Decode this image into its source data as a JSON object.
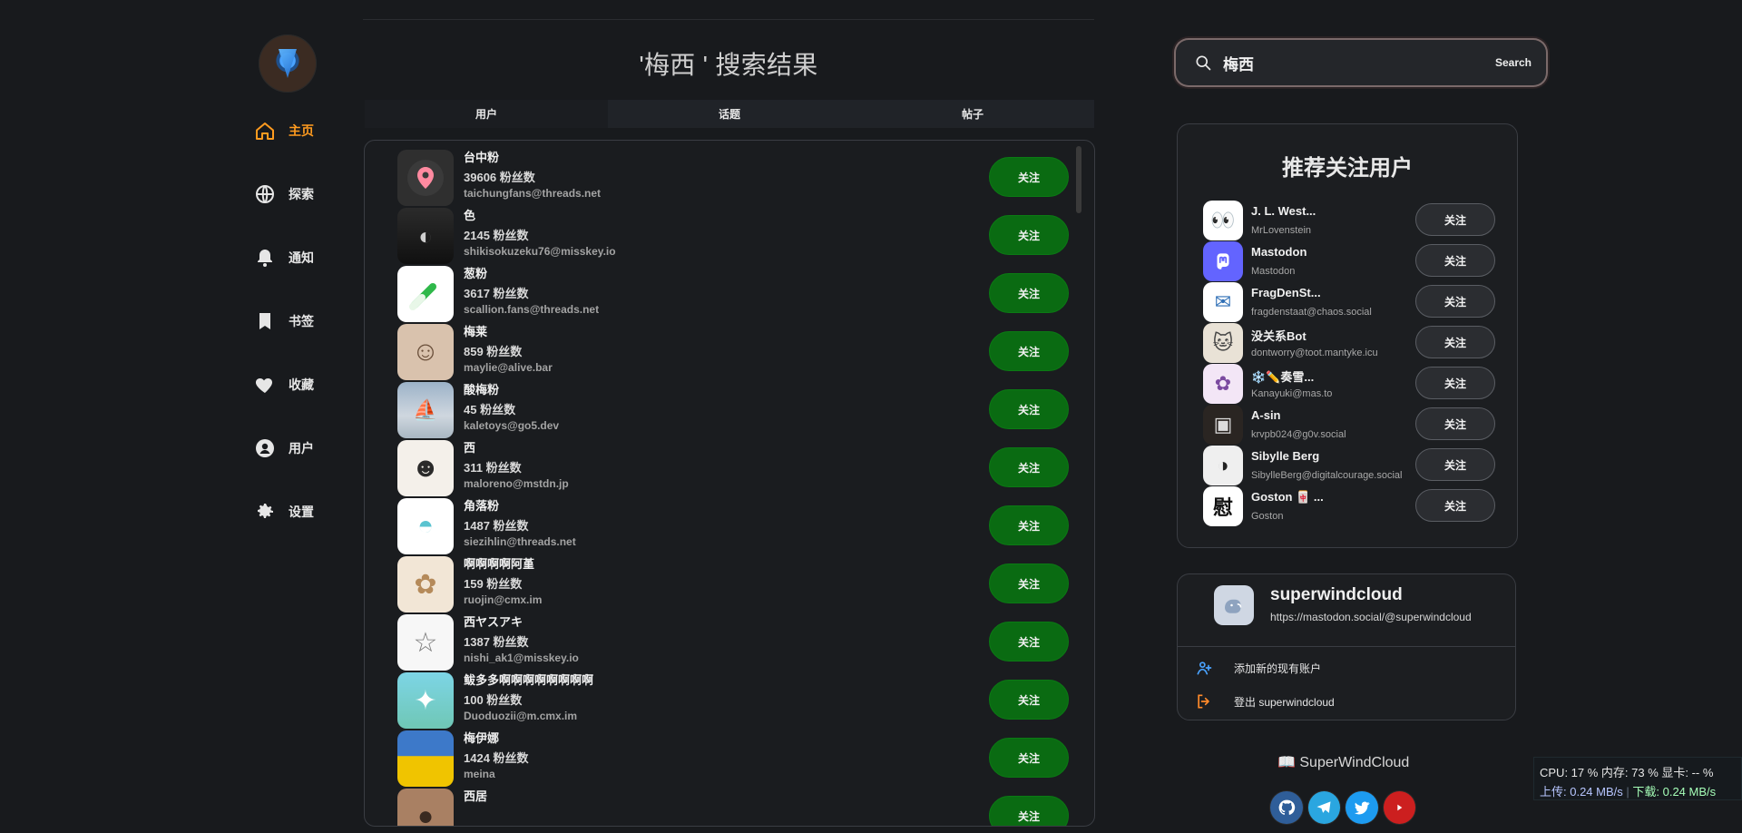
{
  "nav": {
    "items": [
      {
        "label": "主页",
        "icon": "home-icon",
        "active": true
      },
      {
        "label": "探索",
        "icon": "globe-icon",
        "active": false
      },
      {
        "label": "通知",
        "icon": "bell-icon",
        "active": false
      },
      {
        "label": "书签",
        "icon": "bookmark-icon",
        "active": false
      },
      {
        "label": "收藏",
        "icon": "heart-icon",
        "active": false
      },
      {
        "label": "用户",
        "icon": "user-icon",
        "active": false
      },
      {
        "label": "设置",
        "icon": "gear-icon",
        "active": false
      }
    ]
  },
  "main": {
    "title": "'梅西 ' 搜索结果",
    "tabs": [
      {
        "label": "用户",
        "active": true
      },
      {
        "label": "话题",
        "active": false
      },
      {
        "label": "帖子",
        "active": false
      }
    ],
    "results": [
      {
        "name": "台中粉",
        "fans": "39606 粉丝数",
        "handle": "taichungfans@threads.net",
        "icon": "map-pin-icon",
        "follow": "关注"
      },
      {
        "name": "色",
        "fans": "2145 粉丝数",
        "handle": "shikisokuzeku76@misskey.io",
        "icon": "portrait-icon",
        "follow": "关注"
      },
      {
        "name": "葱粉",
        "fans": "3617 粉丝数",
        "handle": "scallion.fans@threads.net",
        "icon": "scallion-icon",
        "follow": "关注"
      },
      {
        "name": "梅莱",
        "fans": "859 粉丝数",
        "handle": "maylie@alive.bar",
        "icon": "cartoon-person-icon",
        "follow": "关注"
      },
      {
        "name": "酸梅粉",
        "fans": "45 粉丝数",
        "handle": "kaletoys@go5.dev",
        "icon": "landscape-icon",
        "follow": "关注"
      },
      {
        "name": "西",
        "fans": "311 粉丝数",
        "handle": "maloreno@mstdn.jp",
        "icon": "anime-face-icon",
        "follow": "关注"
      },
      {
        "name": "角落粉",
        "fans": "1487 粉丝数",
        "handle": "siezihlin@threads.net",
        "icon": "dino-icon",
        "follow": "关注"
      },
      {
        "name": "啊啊啊啊阿堇",
        "fans": "159 粉丝数",
        "handle": "ruojin@cmx.im",
        "icon": "anime-girl-icon",
        "follow": "关注"
      },
      {
        "name": "西ヤスアキ",
        "fans": "1387 粉丝数",
        "handle": "nishi_ak1@misskey.io",
        "icon": "anime-character-icon",
        "follow": "关注"
      },
      {
        "name": "鲅多多啊啊啊啊啊啊啊啊",
        "fans": "100 粉丝数",
        "handle": "Duoduozii@m.cmx.im",
        "icon": "illustration-icon",
        "follow": "关注"
      },
      {
        "name": "梅伊娜",
        "fans": "1424 粉丝数",
        "handle": "meina",
        "icon": "field-icon",
        "follow": "关注"
      },
      {
        "name": "西居",
        "fans": "",
        "handle": "",
        "icon": "partial-avatar-icon",
        "follow": "关注"
      }
    ]
  },
  "search": {
    "value": "梅西",
    "button": "Search",
    "icon": "search-icon"
  },
  "recommend": {
    "title": "推荐关注用户",
    "items": [
      {
        "name": "J. L. West...",
        "handle": "MrLovenstein",
        "icon": "cartoon-eyes-icon",
        "follow": "关注"
      },
      {
        "name": "Mastodon",
        "handle": "Mastodon",
        "icon": "mastodon-icon",
        "follow": "关注"
      },
      {
        "name": "FragDenSt...",
        "handle": "fragdenstaat@chaos.social",
        "icon": "mail-icon",
        "follow": "关注"
      },
      {
        "name": "没关系Bot",
        "handle": "dontworry@toot.mantyke.icu",
        "icon": "cat-icon",
        "follow": "关注"
      },
      {
        "name": "❄️✏️奏雪...",
        "handle": "Kanayuki@mas.to",
        "icon": "anime-girl-icon",
        "follow": "关注"
      },
      {
        "name": "A-sin",
        "handle": "krvpb024@g0v.social",
        "icon": "photo-icon",
        "follow": "关注"
      },
      {
        "name": "Sibylle Berg",
        "handle": "SibylleBerg@digitalcourage.social",
        "icon": "portrait-icon",
        "follow": "关注"
      },
      {
        "name": "Goston 🀄 ...",
        "handle": "Goston",
        "icon": "kanji-icon",
        "follow": "关注"
      }
    ]
  },
  "account": {
    "name": "superwindcloud",
    "url": "https://mastodon.social/@superwindcloud",
    "actions": [
      {
        "label": "添加新的现有账户",
        "icon": "add-user-icon"
      },
      {
        "label": "登出 superwindcloud",
        "icon": "logout-icon"
      }
    ]
  },
  "footer": {
    "brand": "📖 SuperWindCloud",
    "social": [
      {
        "name": "github-icon",
        "color": "#2f5e99"
      },
      {
        "name": "telegram-icon",
        "color": "#2aa6e0"
      },
      {
        "name": "twitter-icon",
        "color": "#1d9bf0"
      },
      {
        "name": "youtube-icon",
        "color": "#cc1f1f"
      }
    ]
  },
  "sysmon": {
    "line1": "CPU: 17 %  内存: 73 %  显卡: -- %",
    "upload": "上传: 0.24 MB/s",
    "download": "下载: 0.24 MB/s"
  },
  "colors": {
    "accent": "#ff9b1f",
    "follow_green": "#0a6b12"
  }
}
